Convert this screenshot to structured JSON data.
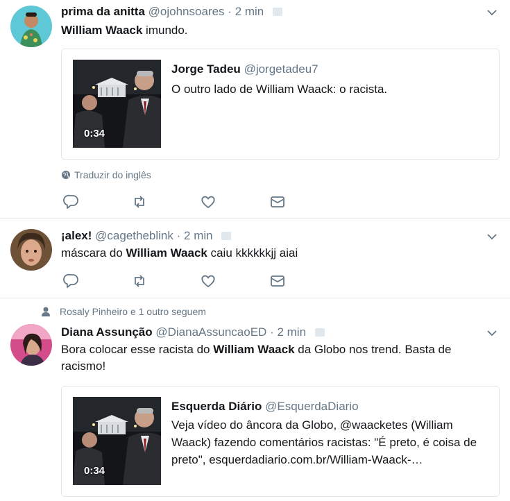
{
  "tweets": [
    {
      "fullname": "prima da anitta",
      "handle": "@ojohnsoares",
      "dot": "·",
      "time": "2 min",
      "text_bold": "William Waack",
      "text_rest": " imundo.",
      "quote": {
        "fullname": "Jorge Tadeu",
        "handle": "@jorgetadeu7",
        "text": "O outro lado de William Waack: o racista.",
        "duration": "0:34"
      },
      "translate": "Traduzir do inglês"
    },
    {
      "fullname": "¡alex!",
      "handle": "@cagetheblink",
      "dot": "·",
      "time": "2 min",
      "text_pre": "máscara do ",
      "text_bold": "William Waack",
      "text_rest": " caiu kkkkkkjj aiai"
    },
    {
      "social_context": "Rosaly Pinheiro e 1 outro seguem",
      "fullname": "Diana Assunção",
      "handle": "@DianaAssuncaoED",
      "dot": "·",
      "time": "2 min",
      "text_pre": "Bora colocar esse racista do ",
      "text_bold": "William Waack",
      "text_rest": " da Globo nos trend. Basta de racismo!",
      "quote": {
        "fullname": "Esquerda Diário",
        "handle": "@EsquerdaDiario",
        "text": "Veja vídeo do âncora da Globo, @waacketes (William Waack) fazendo comentários racistas: \"É preto, é coisa de preto\", esquerdadiario.com.br/William-Waack-…",
        "duration": "0:34"
      }
    }
  ],
  "icons": {
    "reply": "reply-icon",
    "retweet": "retweet-icon",
    "like": "heart-icon",
    "dm": "envelope-icon",
    "menu": "chevron-down-icon",
    "translate": "globe-icon",
    "social": "person-icon"
  },
  "colors": {
    "text": "#14171a",
    "secondary": "#657786",
    "icon": "#657786",
    "border": "#e6ecf0"
  }
}
